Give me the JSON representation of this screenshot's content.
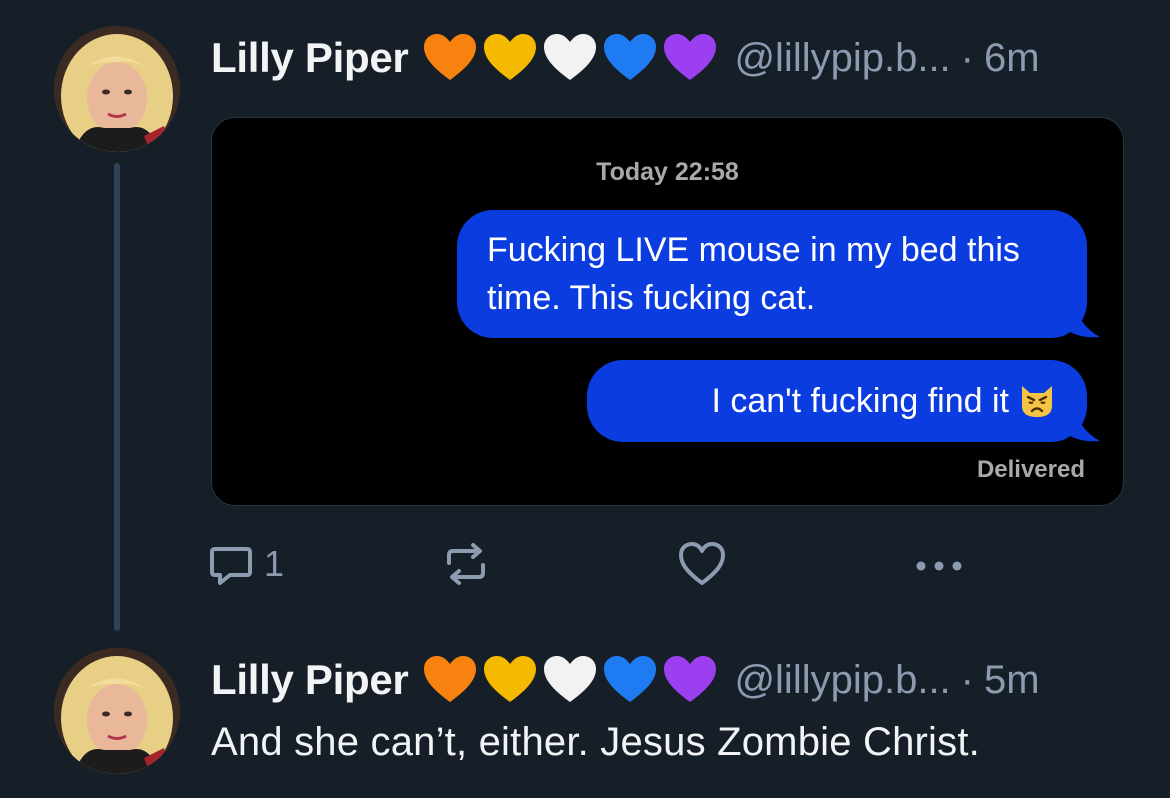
{
  "posts": [
    {
      "author_name": "Lilly Piper",
      "handle": "@lillypip.b...",
      "separator": "·",
      "time": "6m",
      "embed": {
        "timestamp": "Today 22:58",
        "messages": [
          "Fucking LIVE mouse in my bed this time. This fucking cat.",
          "I can't fucking find it"
        ],
        "status": "Delivered"
      },
      "actions": {
        "reply_count": "1"
      }
    },
    {
      "author_name": "Lilly Piper",
      "handle": "@lillypip.b...",
      "separator": "·",
      "time": "5m",
      "text": "And she can’t, either. Jesus Zombie Christ."
    }
  ],
  "heart_colors": [
    "#f7820f",
    "#f5b900",
    "#f2f2f2",
    "#1f7bf2",
    "#9b3ff0"
  ],
  "icons": [
    "reply-icon",
    "repost-icon",
    "like-icon",
    "more-icon",
    "weary-cat-emoji-icon"
  ],
  "colors": {
    "background": "#161e27",
    "imessage_blue": "#0b3ce0",
    "muted_text": "#8c9bb0",
    "thread_line": "#2f4157"
  }
}
